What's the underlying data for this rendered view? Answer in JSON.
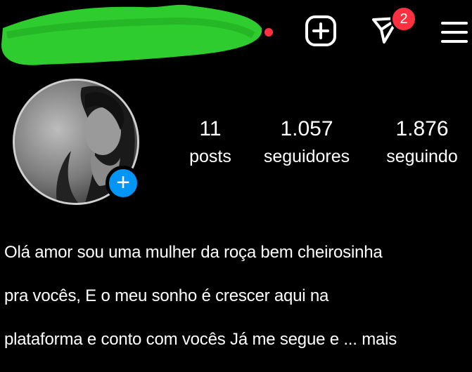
{
  "header": {
    "username_redacted": true,
    "dm_badge": "2"
  },
  "stats": {
    "posts": {
      "value": "11",
      "label": "posts"
    },
    "followers": {
      "value": "1.057",
      "label": "seguidores"
    },
    "following": {
      "value": "1.876",
      "label": "seguindo"
    }
  },
  "bio": {
    "line1": "Olá amor sou uma mulher da roça bem cheirosinha",
    "line2": "pra vocês, E o meu sonho é crescer aqui na",
    "line3": "plataforma e conto com vocês Já me segue e ... mais"
  },
  "icons": {
    "add": "plus-square-icon",
    "dm": "paper-plane-icon",
    "menu": "hamburger-menu-icon",
    "avatar_add": "plus-icon"
  },
  "colors": {
    "background": "#000000",
    "accent_red": "#ff3040",
    "accent_blue": "#0095f6",
    "redaction_green": "#2ecc2e"
  }
}
